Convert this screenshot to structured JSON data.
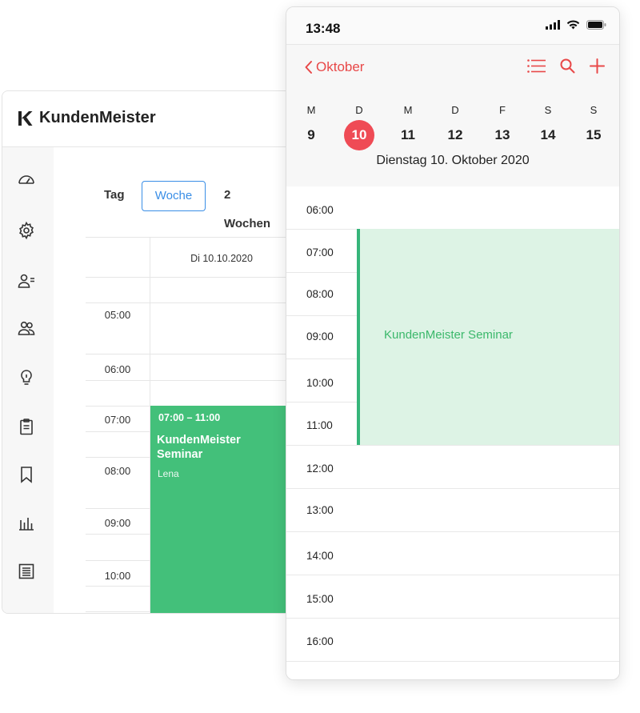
{
  "desktop": {
    "brand": "KundenMeister",
    "sidebar_icons": [
      "dashboard-icon",
      "gear-icon",
      "user-list-icon",
      "users-icon",
      "lightbulb-icon",
      "clipboard-icon",
      "bookmark-icon",
      "bar-chart-icon",
      "report-icon"
    ],
    "view_tabs": [
      {
        "label": "Tag",
        "active": false
      },
      {
        "label": "Woche",
        "active": true
      },
      {
        "label": "2 Wochen",
        "active": false
      }
    ],
    "day_header": "Di 10.10.2020",
    "times": [
      "05:00",
      "06:00",
      "07:00",
      "08:00",
      "09:00",
      "10:00"
    ],
    "event": {
      "time": "07:00 – 11:00",
      "title": "KundenMeister Seminar",
      "person": "Lena",
      "color": "#43c07a"
    }
  },
  "phone": {
    "status_time": "13:48",
    "back_label": "Oktober",
    "nav_icons": [
      "list-icon",
      "search-icon",
      "plus-icon"
    ],
    "weekdays": [
      "M",
      "D",
      "M",
      "D",
      "F",
      "S",
      "S"
    ],
    "dates": [
      "9",
      "10",
      "11",
      "12",
      "13",
      "14",
      "15"
    ],
    "selected_date": "10",
    "date_title": "Dienstag 10. Oktober 2020",
    "hours": [
      "06:00",
      "07:00",
      "08:00",
      "09:00",
      "10:00",
      "11:00",
      "12:00",
      "13:00",
      "14:00",
      "15:00",
      "16:00"
    ],
    "event": {
      "title": "KundenMeister Seminar",
      "color": "#ddf3e5",
      "accent": "#36b57a"
    },
    "accent_color": "#e84848"
  }
}
